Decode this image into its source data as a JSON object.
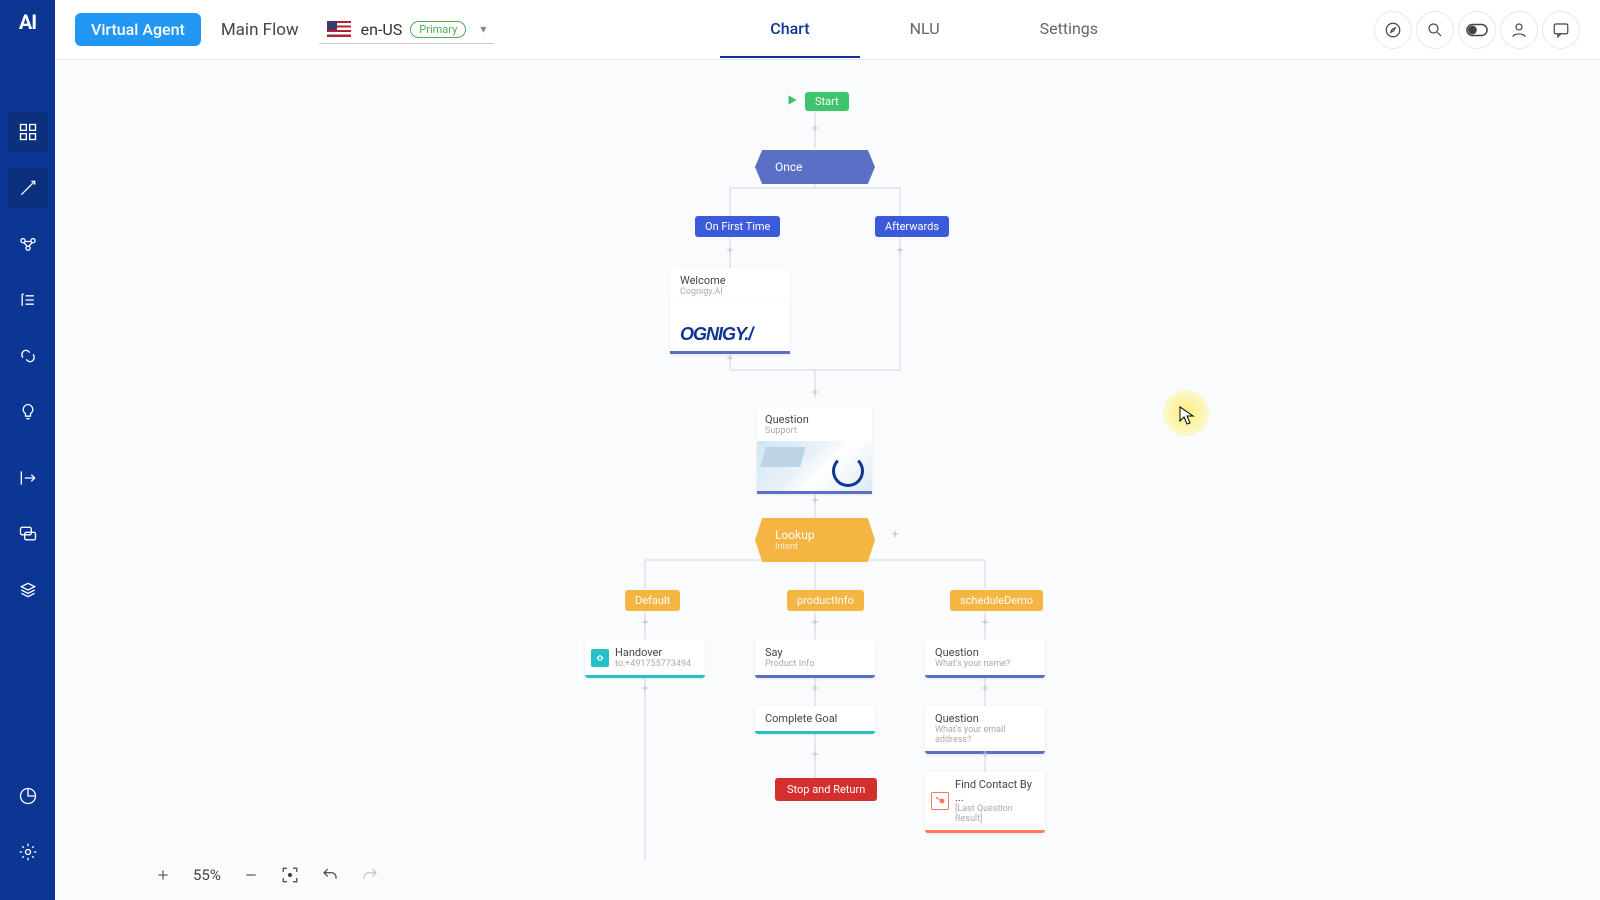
{
  "header": {
    "app_badge": "Virtual Agent",
    "breadcrumb": "Main Flow",
    "locale": "en-US",
    "locale_badge": "Primary"
  },
  "tabs": {
    "chart": "Chart",
    "nlu": "NLU",
    "settings": "Settings"
  },
  "sidebar": {
    "logo": "AI"
  },
  "zoom": {
    "percent": "55%"
  },
  "flow": {
    "start": "Start",
    "once": "Once",
    "on_first_time": "On First Time",
    "afterwards": "Afterwards",
    "welcome": {
      "title": "Welcome",
      "sub": "Cognigy.AI"
    },
    "brand_logo_text": "OGNIGY./",
    "question_support": {
      "title": "Question",
      "sub": "Support"
    },
    "lookup": {
      "title": "Lookup",
      "sub": "Intent"
    },
    "branches": {
      "default": "Default",
      "productInfo": "productInfo",
      "scheduleDemo": "scheduleDemo"
    },
    "handover": {
      "title": "Handover",
      "sub": "to:+491755773494"
    },
    "say": {
      "title": "Say",
      "sub": "Product Info"
    },
    "q_name": {
      "title": "Question",
      "sub": "What's your name?"
    },
    "complete_goal": "Complete Goal",
    "q_email": {
      "title": "Question",
      "sub": "What's your email address?"
    },
    "stop": "Stop and Return",
    "find_contact": {
      "title": "Find Contact By ...",
      "sub": "[Last Question Result]"
    }
  }
}
